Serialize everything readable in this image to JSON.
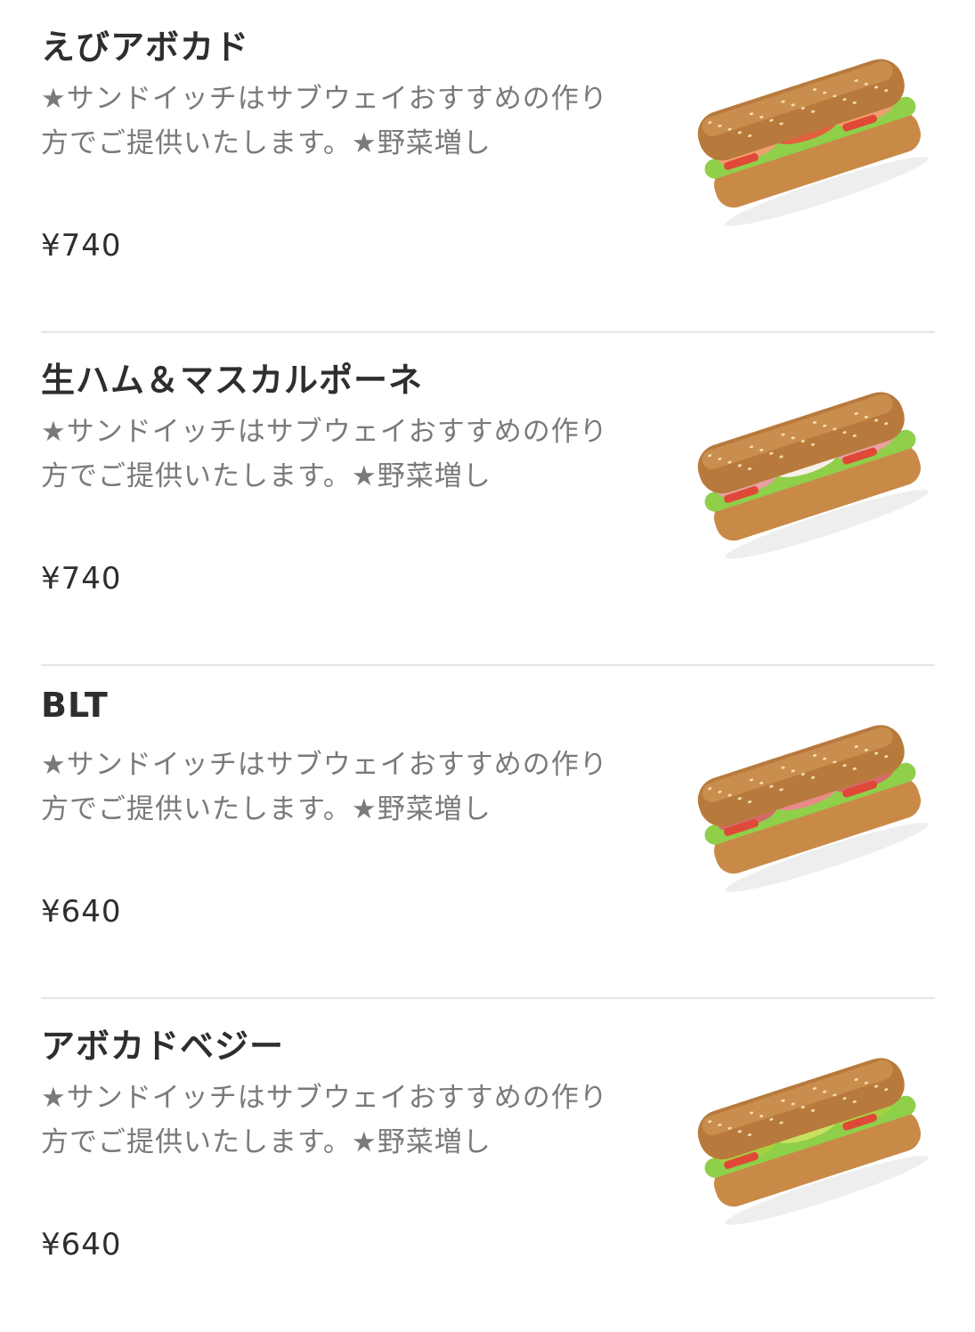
{
  "menu": {
    "items": [
      {
        "name": "えびアボカド",
        "description": "★サンドイッチはサブウェイおすすめの作り方でご提供いたします。★野菜増し",
        "price": "¥740",
        "image_icon": "shrimp-avocado-sandwich-image",
        "filling_colors": [
          "#f0a070",
          "#e06040"
        ]
      },
      {
        "name": "生ハム＆マスカルポーネ",
        "description": "★サンドイッチはサブウェイおすすめの作り方でご提供いたします。★野菜増し",
        "price": "¥740",
        "image_icon": "prosciutto-mascarpone-sandwich-image",
        "filling_colors": [
          "#e8a0a0",
          "#f6f0e6"
        ]
      },
      {
        "name": "BLT",
        "description": "★サンドイッチはサブウェイおすすめの作り方でご提供いたします。★野菜増し",
        "price": "¥640",
        "image_icon": "blt-sandwich-image",
        "filling_colors": [
          "#d46a6a",
          "#e88a8a"
        ]
      },
      {
        "name": "アボカドベジー",
        "description": "★サンドイッチはサブウェイおすすめの作り方でご提供いたします。★野菜増し",
        "price": "¥640",
        "image_icon": "avocado-veggie-sandwich-image",
        "filling_colors": [
          "#a8d040",
          "#c8e060"
        ]
      }
    ]
  }
}
